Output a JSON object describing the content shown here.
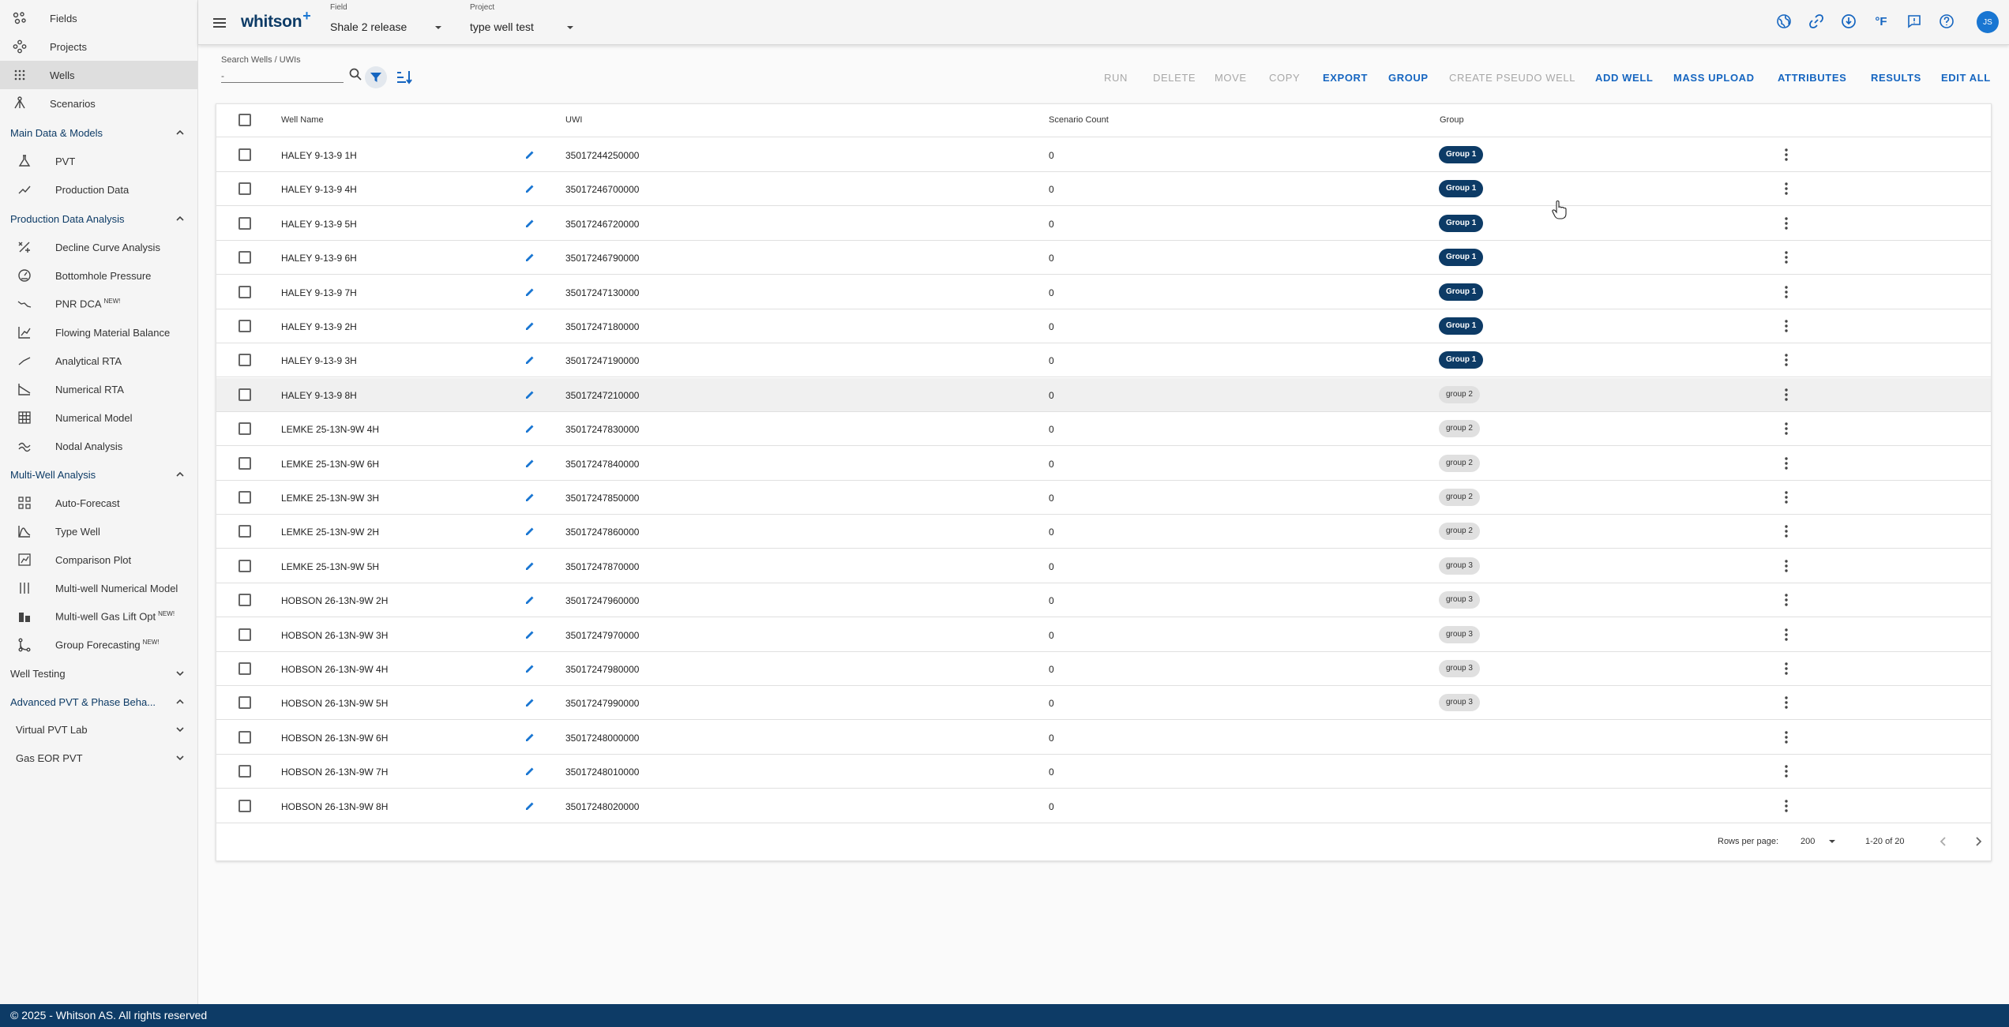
{
  "sidebar": {
    "top_items": [
      {
        "label": "Fields",
        "icon": "scatter-icon"
      },
      {
        "label": "Projects",
        "icon": "nodes-icon"
      },
      {
        "label": "Wells",
        "icon": "grid-dots-icon"
      },
      {
        "label": "Scenarios",
        "icon": "tree-icon"
      }
    ],
    "sections": {
      "main": {
        "label": "Main Data & Models",
        "items": [
          {
            "label": "PVT",
            "icon": "flask-icon"
          },
          {
            "label": "Production Data",
            "icon": "trend-icon"
          }
        ]
      },
      "pda": {
        "label": "Production Data Analysis",
        "items": [
          {
            "label": "Decline Curve Analysis",
            "icon": "decline-icon"
          },
          {
            "label": "Bottomhole Pressure",
            "icon": "gauge-icon"
          },
          {
            "label": "PNR DCA",
            "badge": "NEW!",
            "icon": "pnr-icon"
          },
          {
            "label": "Flowing Material Balance",
            "icon": "chart-icon"
          },
          {
            "label": "Analytical RTA",
            "icon": "rta-icon"
          },
          {
            "label": "Numerical RTA",
            "icon": "numrta-icon"
          },
          {
            "label": "Numerical Model",
            "icon": "grid-icon"
          },
          {
            "label": "Nodal Analysis",
            "icon": "wave-icon"
          }
        ]
      },
      "mwa": {
        "label": "Multi-Well Analysis",
        "items": [
          {
            "label": "Auto-Forecast",
            "icon": "apps-icon"
          },
          {
            "label": "Type Well",
            "icon": "bell-curve-icon"
          },
          {
            "label": "Comparison Plot",
            "icon": "compare-icon"
          },
          {
            "label": "Multi-well Numerical Model",
            "icon": "columns-icon"
          },
          {
            "label": "Multi-well Gas Lift Opt",
            "badge": "NEW!",
            "icon": "building-icon"
          },
          {
            "label": "Group Forecasting",
            "badge": "NEW!",
            "icon": "branch-icon"
          }
        ]
      },
      "well_testing": {
        "label": "Well Testing"
      },
      "advanced_pvt": {
        "label": "Advanced PVT & Phase Beha...",
        "items": [
          {
            "label": "Virtual PVT Lab"
          },
          {
            "label": "Gas EOR PVT"
          }
        ]
      }
    }
  },
  "topbar": {
    "logo": "whitson",
    "logo_mark": "+",
    "field_caption": "Field",
    "field_value": "Shale 2 release",
    "project_caption": "Project",
    "project_value": "type well test",
    "temp_unit": "°F",
    "avatar": "JS"
  },
  "toolbar": {
    "search_caption": "Search Wells / UWIs",
    "search_value": "-",
    "actions": {
      "run": "RUN",
      "delete": "DELETE",
      "move": "MOVE",
      "copy": "COPY",
      "export": "EXPORT",
      "group": "GROUP",
      "create_pseudo": "CREATE PSEUDO WELL",
      "add_well": "ADD WELL",
      "mass_upload": "MASS UPLOAD",
      "attributes": "ATTRIBUTES",
      "results": "RESULTS",
      "edit_all": "EDIT ALL"
    }
  },
  "table": {
    "headers": {
      "name": "Well Name",
      "uwi": "UWI",
      "scenario": "Scenario Count",
      "group": "Group"
    },
    "rows": [
      {
        "name": "HALEY 9-13-9 1H",
        "uwi": "35017244250000",
        "count": "0",
        "group": "Group 1"
      },
      {
        "name": "HALEY 9-13-9 4H",
        "uwi": "35017246700000",
        "count": "0",
        "group": "Group 1"
      },
      {
        "name": "HALEY 9-13-9 5H",
        "uwi": "35017246720000",
        "count": "0",
        "group": "Group 1"
      },
      {
        "name": "HALEY 9-13-9 6H",
        "uwi": "35017246790000",
        "count": "0",
        "group": "Group 1"
      },
      {
        "name": "HALEY 9-13-9 7H",
        "uwi": "35017247130000",
        "count": "0",
        "group": "Group 1"
      },
      {
        "name": "HALEY 9-13-9 2H",
        "uwi": "35017247180000",
        "count": "0",
        "group": "Group 1"
      },
      {
        "name": "HALEY 9-13-9 3H",
        "uwi": "35017247190000",
        "count": "0",
        "group": "Group 1"
      },
      {
        "name": "HALEY 9-13-9 8H",
        "uwi": "35017247210000",
        "count": "0",
        "group": "group 2"
      },
      {
        "name": "LEMKE 25-13N-9W 4H",
        "uwi": "35017247830000",
        "count": "0",
        "group": "group 2"
      },
      {
        "name": "LEMKE 25-13N-9W 6H",
        "uwi": "35017247840000",
        "count": "0",
        "group": "group 2"
      },
      {
        "name": "LEMKE 25-13N-9W 3H",
        "uwi": "35017247850000",
        "count": "0",
        "group": "group 2"
      },
      {
        "name": "LEMKE 25-13N-9W 2H",
        "uwi": "35017247860000",
        "count": "0",
        "group": "group 2"
      },
      {
        "name": "LEMKE 25-13N-9W 5H",
        "uwi": "35017247870000",
        "count": "0",
        "group": "group 3"
      },
      {
        "name": "HOBSON 26-13N-9W 2H",
        "uwi": "35017247960000",
        "count": "0",
        "group": "group 3"
      },
      {
        "name": "HOBSON 26-13N-9W 3H",
        "uwi": "35017247970000",
        "count": "0",
        "group": "group 3"
      },
      {
        "name": "HOBSON 26-13N-9W 4H",
        "uwi": "35017247980000",
        "count": "0",
        "group": "group 3"
      },
      {
        "name": "HOBSON 26-13N-9W 5H",
        "uwi": "35017247990000",
        "count": "0",
        "group": "group 3"
      },
      {
        "name": "HOBSON 26-13N-9W 6H",
        "uwi": "35017248000000",
        "count": "0",
        "group": ""
      },
      {
        "name": "HOBSON 26-13N-9W 7H",
        "uwi": "35017248010000",
        "count": "0",
        "group": ""
      },
      {
        "name": "HOBSON 26-13N-9W 8H",
        "uwi": "35017248020000",
        "count": "0",
        "group": ""
      }
    ],
    "pagination": {
      "rows_label": "Rows per page:",
      "rows_value": "200",
      "range": "1-20 of 20"
    }
  },
  "footer": {
    "text": "© 2025 - Whitson AS. All rights reserved"
  }
}
